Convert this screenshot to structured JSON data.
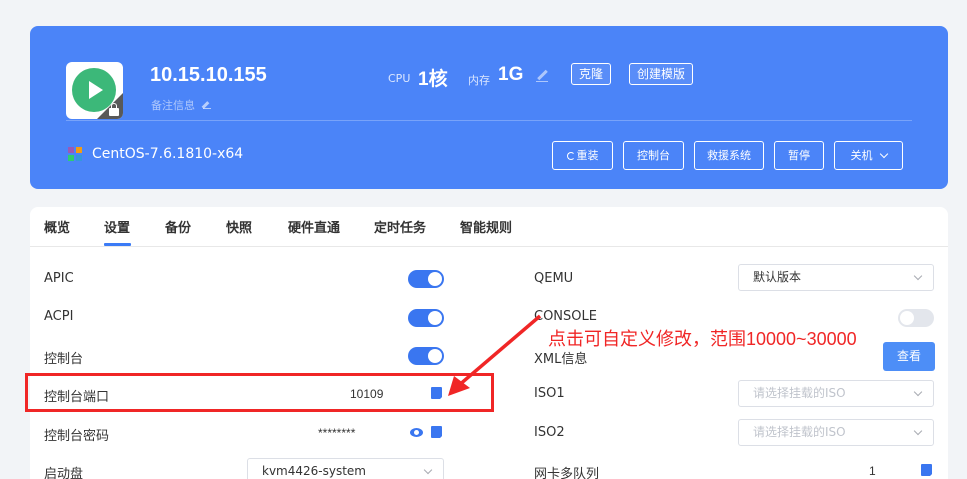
{
  "vm": {
    "ip": "10.15.10.155",
    "note_label": "备注信息",
    "cpu_label": "CPU",
    "cpu_value": "1核",
    "mem_label": "内存",
    "mem_value": "1G",
    "clone_label": "克隆",
    "template_label": "创建模版",
    "os": "CentOS-7.6.1810-x64",
    "actions": {
      "reinstall": "重装",
      "console": "控制台",
      "rescue": "救援系统",
      "pause": "暂停",
      "shutdown": "关机"
    }
  },
  "tabs": [
    "概览",
    "设置",
    "备份",
    "快照",
    "硬件直通",
    "定时任务",
    "智能规则"
  ],
  "active_tab": "设置",
  "left_settings": {
    "apic": {
      "label": "APIC",
      "on": true
    },
    "acpi": {
      "label": "ACPI",
      "on": true
    },
    "console": {
      "label": "控制台",
      "on": true
    },
    "console_port": {
      "label": "控制台端口",
      "value": "10109"
    },
    "console_password": {
      "label": "控制台密码",
      "value": "********"
    },
    "boot_disk": {
      "label": "启动盘",
      "value": "kvm4426-system"
    }
  },
  "right_settings": {
    "qemu": {
      "label": "QEMU",
      "value": "默认版本"
    },
    "console": {
      "label": "CONSOLE",
      "on": false
    },
    "xml": {
      "label": "XML信息",
      "button": "查看"
    },
    "iso1": {
      "label": "ISO1",
      "placeholder": "请选择挂载的ISO"
    },
    "iso2": {
      "label": "ISO2",
      "placeholder": "请选择挂载的ISO"
    },
    "nic_queue": {
      "label": "网卡多队列",
      "value": "1"
    }
  },
  "annotation": "点击可自定义修改，范围10000~30000",
  "colors": {
    "brand": "#4b84f8",
    "accent": "#3a76f0",
    "annotation": "#f02626"
  }
}
